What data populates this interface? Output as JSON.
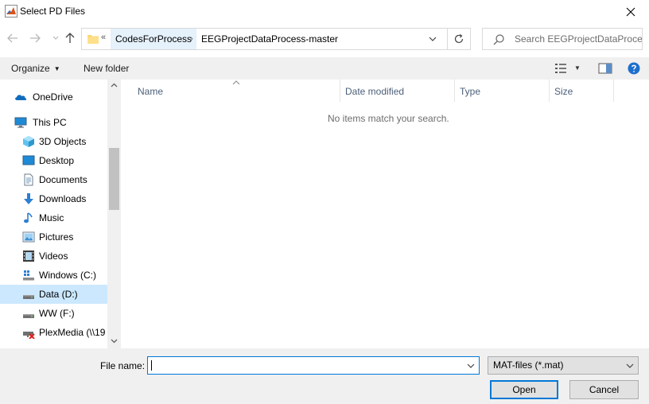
{
  "window": {
    "title": "Select PD Files"
  },
  "address": {
    "overflow_chevrons": "«",
    "crumbs": [
      "CodesForProcess",
      "EEGProjectDataProcess-master"
    ],
    "separator": "›"
  },
  "search": {
    "placeholder": "Search EEGProjectDataProce..."
  },
  "toolbar": {
    "organize_label": "Organize",
    "organize_caret": "▼",
    "new_folder_label": "New folder",
    "view_caret": "▼"
  },
  "navigation": {
    "items": [
      {
        "label": "OneDrive",
        "icon": "onedrive-icon"
      },
      {
        "label": "This PC",
        "icon": "computer-icon"
      },
      {
        "label": "3D Objects",
        "icon": "cube-icon"
      },
      {
        "label": "Desktop",
        "icon": "desktop-icon"
      },
      {
        "label": "Documents",
        "icon": "document-icon"
      },
      {
        "label": "Downloads",
        "icon": "download-icon"
      },
      {
        "label": "Music",
        "icon": "music-icon"
      },
      {
        "label": "Pictures",
        "icon": "pictures-icon"
      },
      {
        "label": "Videos",
        "icon": "videos-icon"
      },
      {
        "label": "Windows (C:)",
        "icon": "windows-drive-icon"
      },
      {
        "label": "Data (D:)",
        "icon": "drive-icon",
        "selected": true
      },
      {
        "label": "WW (F:)",
        "icon": "drive-icon"
      },
      {
        "label": "PlexMedia (\\\\19",
        "icon": "network-drive-disconnected-icon"
      }
    ]
  },
  "file_list": {
    "columns": [
      "Name",
      "Date modified",
      "Type",
      "Size"
    ],
    "empty_message": "No items match your search."
  },
  "footer": {
    "file_name_label": "File name:",
    "file_name_value": "",
    "file_type_value": "MAT-files (*.mat)",
    "open_label": "Open",
    "cancel_label": "Cancel"
  },
  "colors": {
    "accent": "#0078d7",
    "selection": "#cce8ff",
    "crumb_highlight": "#e5f1fb",
    "help": "#1e6fcc"
  }
}
